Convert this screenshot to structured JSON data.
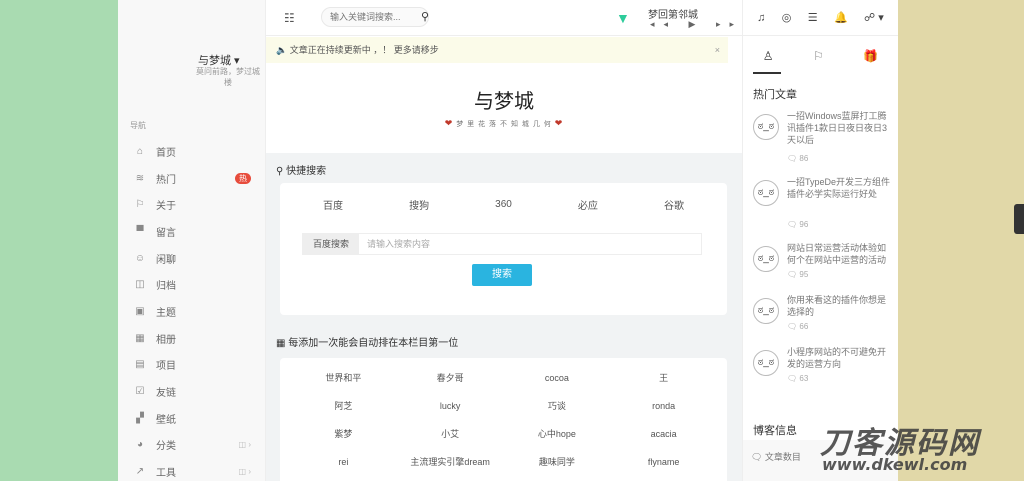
{
  "header": {
    "search_placeholder": "输入关键词搜索...",
    "song_title": "梦回第邻城"
  },
  "sidebar": {
    "brand": "与梦城 ▾",
    "brand_sub": "莫问前路，梦过城楼",
    "nav_head": "导航",
    "items": [
      {
        "label": "首页",
        "icon": "home-icon",
        "glyph": "⌂"
      },
      {
        "label": "热门",
        "icon": "fire-icon",
        "glyph": "≋",
        "badge": "热"
      },
      {
        "label": "关于",
        "icon": "user-icon",
        "glyph": "⚐"
      },
      {
        "label": "留言",
        "icon": "comment-icon",
        "glyph": "▀"
      },
      {
        "label": "闲聊",
        "icon": "chat-icon",
        "glyph": "☺"
      },
      {
        "label": "归档",
        "icon": "archive-icon",
        "glyph": "◫"
      },
      {
        "label": "主题",
        "icon": "theme-icon",
        "glyph": "▣"
      },
      {
        "label": "相册",
        "icon": "album-icon",
        "glyph": "▦"
      },
      {
        "label": "项目",
        "icon": "project-icon",
        "glyph": "▤"
      },
      {
        "label": "友链",
        "icon": "link-icon",
        "glyph": "☑"
      },
      {
        "label": "壁纸",
        "icon": "wallpaper-icon",
        "glyph": "▞"
      },
      {
        "label": "分类",
        "icon": "category-icon",
        "glyph": "◕",
        "caret": "◫ ›"
      },
      {
        "label": "工具",
        "icon": "tool-icon",
        "glyph": "↗",
        "caret": "◫ ›"
      }
    ]
  },
  "notice": {
    "text": "🔈 文章正在持续更新中 ，！ 更多请移步",
    "close": "×"
  },
  "main": {
    "site_title": "与梦城",
    "site_sub": "梦 里 花 落 不 知 城 几 何",
    "search_section_title": "快捷搜索",
    "engines": [
      "百度",
      "搜狗",
      "360",
      "必应",
      "谷歌"
    ],
    "search_left_button": "百度搜索",
    "search_box_placeholder": "请输入搜索内容",
    "submit_label": "搜索",
    "keyword_section_title": "每添加一次能会自动排在本栏目第一位",
    "keywords": [
      "世界和平",
      "春夕哥",
      "cocoa",
      "王",
      "阿芝",
      "lucky",
      "巧谈",
      "ronda",
      "紫梦",
      "小艾",
      "心中hope",
      "acacia",
      "rei",
      "主流理实引擎dream",
      "趣味同学",
      "flyname"
    ]
  },
  "right_sidebar": {
    "top_icons": [
      "♫",
      "◎",
      "☰",
      "🔔",
      "☍ ▾"
    ],
    "tabs": [
      "♙",
      "⚐",
      "🎁"
    ],
    "hot_title": "热门文章",
    "posts": [
      {
        "title": "一招Windows蓝屏打工腾讯插件1款日日夜日夜日3天以后",
        "views": "🗨 86"
      },
      {
        "title": "一招TypeDe开发三方组件插件必学实际运行好处",
        "views": "🗨 96"
      },
      {
        "title": "网站日常运营活动体验如何个在网站中运营的活动",
        "views": "🗨 95"
      },
      {
        "title": "你用来看这的插件你想是选择的",
        "views": "🗨 66"
      },
      {
        "title": "小程序网站的不可避免开发的运营方向",
        "views": "🗨 63"
      }
    ],
    "blog_info_title": "博客信息",
    "blog_item": "🗨 文章数目"
  },
  "watermark": {
    "main": "刀客源码网",
    "sub": "www.dkewl.com"
  }
}
